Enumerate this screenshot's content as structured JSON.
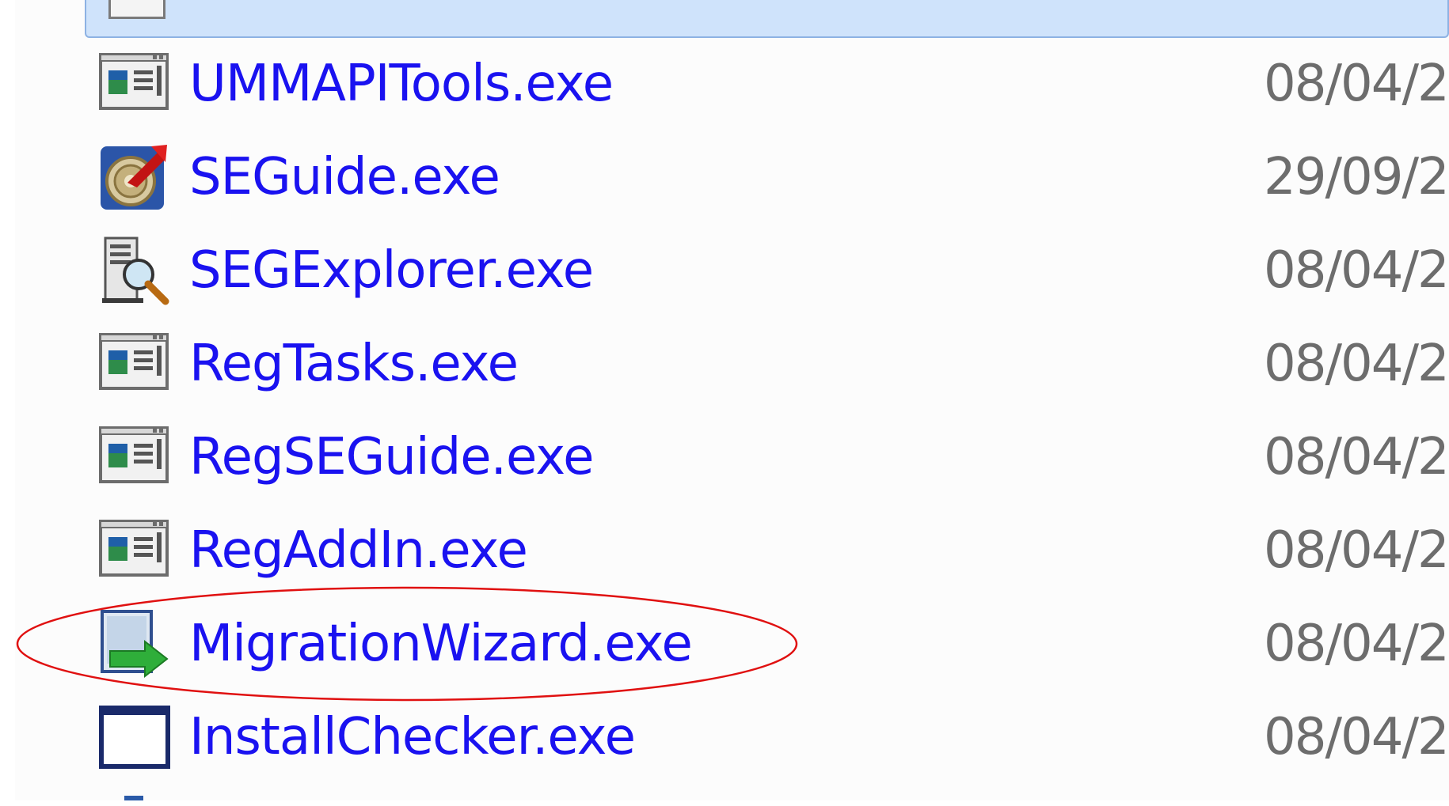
{
  "file_list": {
    "selected_row": {
      "icon": "generic-window-icon"
    },
    "rows": [
      {
        "name": "UMMAPITools.exe",
        "date": "08/04/2",
        "icon": "application-window-icon"
      },
      {
        "name": "SEGuide.exe",
        "date": "29/09/2",
        "icon": "compass-arrow-icon"
      },
      {
        "name": "SEGExplorer.exe",
        "date": "08/04/2",
        "icon": "document-magnifier-icon"
      },
      {
        "name": "RegTasks.exe",
        "date": "08/04/2",
        "icon": "application-window-icon"
      },
      {
        "name": "RegSEGuide.exe",
        "date": "08/04/2",
        "icon": "application-window-icon"
      },
      {
        "name": "RegAddIn.exe",
        "date": "08/04/2",
        "icon": "application-window-icon"
      },
      {
        "name": "MigrationWizard.exe",
        "date": "08/04/2",
        "icon": "migration-arrow-icon",
        "highlighted": true
      },
      {
        "name": "InstallChecker.exe",
        "date": "08/04/2",
        "icon": "blank-window-icon"
      }
    ]
  },
  "annotation": {
    "shape": "ellipse",
    "color": "#e01010",
    "target": "MigrationWizard.exe"
  },
  "colors": {
    "file_name": "#1a12f0",
    "date": "#6d6d6d",
    "selection_fill": "#cfe3fb",
    "selection_border": "#8db2e3",
    "pane_background": "#fcfcfc"
  }
}
